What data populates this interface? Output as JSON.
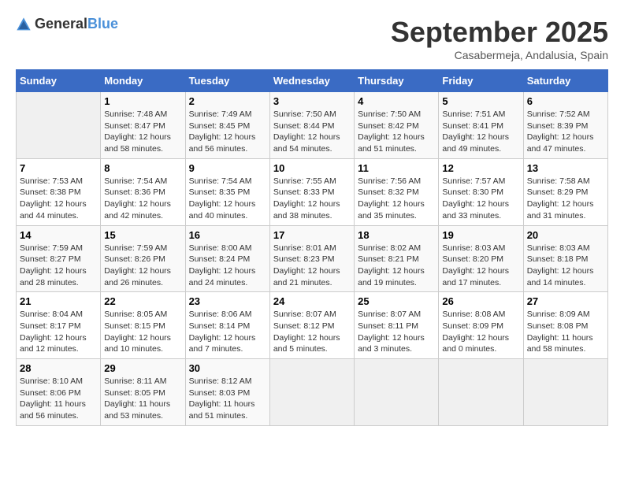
{
  "logo": {
    "general": "General",
    "blue": "Blue"
  },
  "header": {
    "month": "September 2025",
    "location": "Casabermeja, Andalusia, Spain"
  },
  "days_of_week": [
    "Sunday",
    "Monday",
    "Tuesday",
    "Wednesday",
    "Thursday",
    "Friday",
    "Saturday"
  ],
  "weeks": [
    [
      {
        "day": "",
        "info": ""
      },
      {
        "day": "1",
        "info": "Sunrise: 7:48 AM\nSunset: 8:47 PM\nDaylight: 12 hours\nand 58 minutes."
      },
      {
        "day": "2",
        "info": "Sunrise: 7:49 AM\nSunset: 8:45 PM\nDaylight: 12 hours\nand 56 minutes."
      },
      {
        "day": "3",
        "info": "Sunrise: 7:50 AM\nSunset: 8:44 PM\nDaylight: 12 hours\nand 54 minutes."
      },
      {
        "day": "4",
        "info": "Sunrise: 7:50 AM\nSunset: 8:42 PM\nDaylight: 12 hours\nand 51 minutes."
      },
      {
        "day": "5",
        "info": "Sunrise: 7:51 AM\nSunset: 8:41 PM\nDaylight: 12 hours\nand 49 minutes."
      },
      {
        "day": "6",
        "info": "Sunrise: 7:52 AM\nSunset: 8:39 PM\nDaylight: 12 hours\nand 47 minutes."
      }
    ],
    [
      {
        "day": "7",
        "info": "Sunrise: 7:53 AM\nSunset: 8:38 PM\nDaylight: 12 hours\nand 44 minutes."
      },
      {
        "day": "8",
        "info": "Sunrise: 7:54 AM\nSunset: 8:36 PM\nDaylight: 12 hours\nand 42 minutes."
      },
      {
        "day": "9",
        "info": "Sunrise: 7:54 AM\nSunset: 8:35 PM\nDaylight: 12 hours\nand 40 minutes."
      },
      {
        "day": "10",
        "info": "Sunrise: 7:55 AM\nSunset: 8:33 PM\nDaylight: 12 hours\nand 38 minutes."
      },
      {
        "day": "11",
        "info": "Sunrise: 7:56 AM\nSunset: 8:32 PM\nDaylight: 12 hours\nand 35 minutes."
      },
      {
        "day": "12",
        "info": "Sunrise: 7:57 AM\nSunset: 8:30 PM\nDaylight: 12 hours\nand 33 minutes."
      },
      {
        "day": "13",
        "info": "Sunrise: 7:58 AM\nSunset: 8:29 PM\nDaylight: 12 hours\nand 31 minutes."
      }
    ],
    [
      {
        "day": "14",
        "info": "Sunrise: 7:59 AM\nSunset: 8:27 PM\nDaylight: 12 hours\nand 28 minutes."
      },
      {
        "day": "15",
        "info": "Sunrise: 7:59 AM\nSunset: 8:26 PM\nDaylight: 12 hours\nand 26 minutes."
      },
      {
        "day": "16",
        "info": "Sunrise: 8:00 AM\nSunset: 8:24 PM\nDaylight: 12 hours\nand 24 minutes."
      },
      {
        "day": "17",
        "info": "Sunrise: 8:01 AM\nSunset: 8:23 PM\nDaylight: 12 hours\nand 21 minutes."
      },
      {
        "day": "18",
        "info": "Sunrise: 8:02 AM\nSunset: 8:21 PM\nDaylight: 12 hours\nand 19 minutes."
      },
      {
        "day": "19",
        "info": "Sunrise: 8:03 AM\nSunset: 8:20 PM\nDaylight: 12 hours\nand 17 minutes."
      },
      {
        "day": "20",
        "info": "Sunrise: 8:03 AM\nSunset: 8:18 PM\nDaylight: 12 hours\nand 14 minutes."
      }
    ],
    [
      {
        "day": "21",
        "info": "Sunrise: 8:04 AM\nSunset: 8:17 PM\nDaylight: 12 hours\nand 12 minutes."
      },
      {
        "day": "22",
        "info": "Sunrise: 8:05 AM\nSunset: 8:15 PM\nDaylight: 12 hours\nand 10 minutes."
      },
      {
        "day": "23",
        "info": "Sunrise: 8:06 AM\nSunset: 8:14 PM\nDaylight: 12 hours\nand 7 minutes."
      },
      {
        "day": "24",
        "info": "Sunrise: 8:07 AM\nSunset: 8:12 PM\nDaylight: 12 hours\nand 5 minutes."
      },
      {
        "day": "25",
        "info": "Sunrise: 8:07 AM\nSunset: 8:11 PM\nDaylight: 12 hours\nand 3 minutes."
      },
      {
        "day": "26",
        "info": "Sunrise: 8:08 AM\nSunset: 8:09 PM\nDaylight: 12 hours\nand 0 minutes."
      },
      {
        "day": "27",
        "info": "Sunrise: 8:09 AM\nSunset: 8:08 PM\nDaylight: 11 hours\nand 58 minutes."
      }
    ],
    [
      {
        "day": "28",
        "info": "Sunrise: 8:10 AM\nSunset: 8:06 PM\nDaylight: 11 hours\nand 56 minutes."
      },
      {
        "day": "29",
        "info": "Sunrise: 8:11 AM\nSunset: 8:05 PM\nDaylight: 11 hours\nand 53 minutes."
      },
      {
        "day": "30",
        "info": "Sunrise: 8:12 AM\nSunset: 8:03 PM\nDaylight: 11 hours\nand 51 minutes."
      },
      {
        "day": "",
        "info": ""
      },
      {
        "day": "",
        "info": ""
      },
      {
        "day": "",
        "info": ""
      },
      {
        "day": "",
        "info": ""
      }
    ]
  ]
}
